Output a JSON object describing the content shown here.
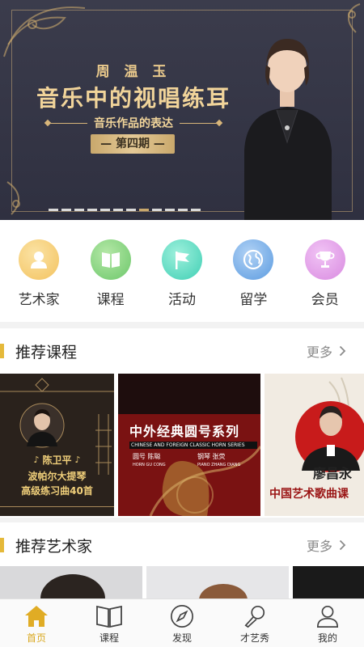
{
  "banner": {
    "name": "周 温 玉",
    "title": "音乐中的视唱练耳",
    "subtitle": "音乐作品的表达",
    "issue": "— 第四期 —",
    "slide_count": 12,
    "active_slide": 7
  },
  "categories": [
    {
      "label": "艺术家",
      "icon": "artist-icon",
      "color": "#f3c25e"
    },
    {
      "label": "课程",
      "icon": "book-icon",
      "color": "#6cc76a"
    },
    {
      "label": "活动",
      "icon": "flag-icon",
      "color": "#3fcfb4"
    },
    {
      "label": "留学",
      "icon": "globe-icon",
      "color": "#5b9be0"
    },
    {
      "label": "会员",
      "icon": "trophy-icon",
      "color": "#d98ae0"
    }
  ],
  "recommended_courses": {
    "title": "推荐课程",
    "more": "更多",
    "cards": [
      {
        "teacher": "陈卫平",
        "line1": "波帕尔大提琴",
        "line2": "高级练习曲40首"
      },
      {
        "title": "中外经典圆号系列",
        "subtitle": "CHINESE AND FOREIGN CLASSIC HORN SERIES",
        "credit1": "圆号 陈聪",
        "credit1_en": "HORN GU CONG",
        "credit2": "钢琴 张荧",
        "credit2_en": "PIANO ZHANG DIANG"
      },
      {
        "teacher": "廖昌永",
        "line1": "中国艺术歌曲课"
      }
    ]
  },
  "recommended_artists": {
    "title": "推荐艺术家",
    "more": "更多"
  },
  "tabbar": [
    {
      "label": "首页",
      "icon": "home-icon",
      "active": true
    },
    {
      "label": "课程",
      "icon": "book-icon",
      "active": false
    },
    {
      "label": "发现",
      "icon": "compass-icon",
      "active": false
    },
    {
      "label": "才艺秀",
      "icon": "microphone-icon",
      "active": false
    },
    {
      "label": "我的",
      "icon": "profile-icon",
      "active": false
    }
  ]
}
